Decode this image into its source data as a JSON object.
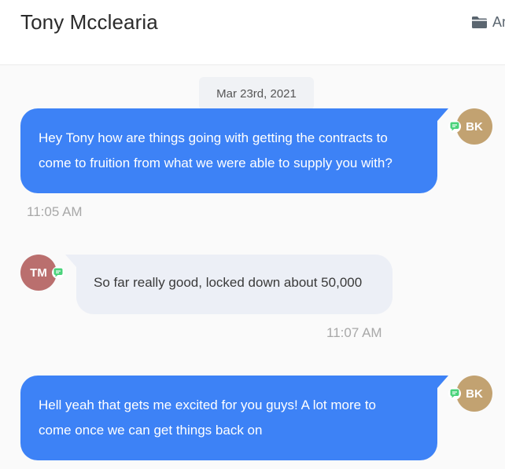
{
  "header": {
    "title": "Tony Mcclearia",
    "archive_label": "Ar"
  },
  "thread": {
    "date_divider": "Mar 23rd, 2021",
    "messages": [
      {
        "direction": "outgoing",
        "lines": [
          "Hey Tony how are things going with getting the contracts to",
          "come to fruition from what we were able to supply you with?"
        ],
        "time": "11:05 AM",
        "avatar_initials": "BK",
        "channel_icon": "sms-icon"
      },
      {
        "direction": "incoming",
        "lines": [
          "So far really good, locked down about 50,000"
        ],
        "time": "11:07 AM",
        "avatar_initials": "TM",
        "channel_icon": "sms-icon"
      },
      {
        "direction": "outgoing",
        "lines": [
          "Hell yeah that gets me excited for you guys! A lot more to",
          "come once we can get things back on"
        ],
        "time": "",
        "avatar_initials": "BK",
        "channel_icon": "sms-icon"
      }
    ]
  },
  "colors": {
    "outgoing_bubble": "#3d82f6",
    "incoming_bubble": "#eceff6",
    "avatar_bk": "#c2a271",
    "avatar_tm": "#ba6f6e",
    "sms_badge": "#4bd37b"
  }
}
